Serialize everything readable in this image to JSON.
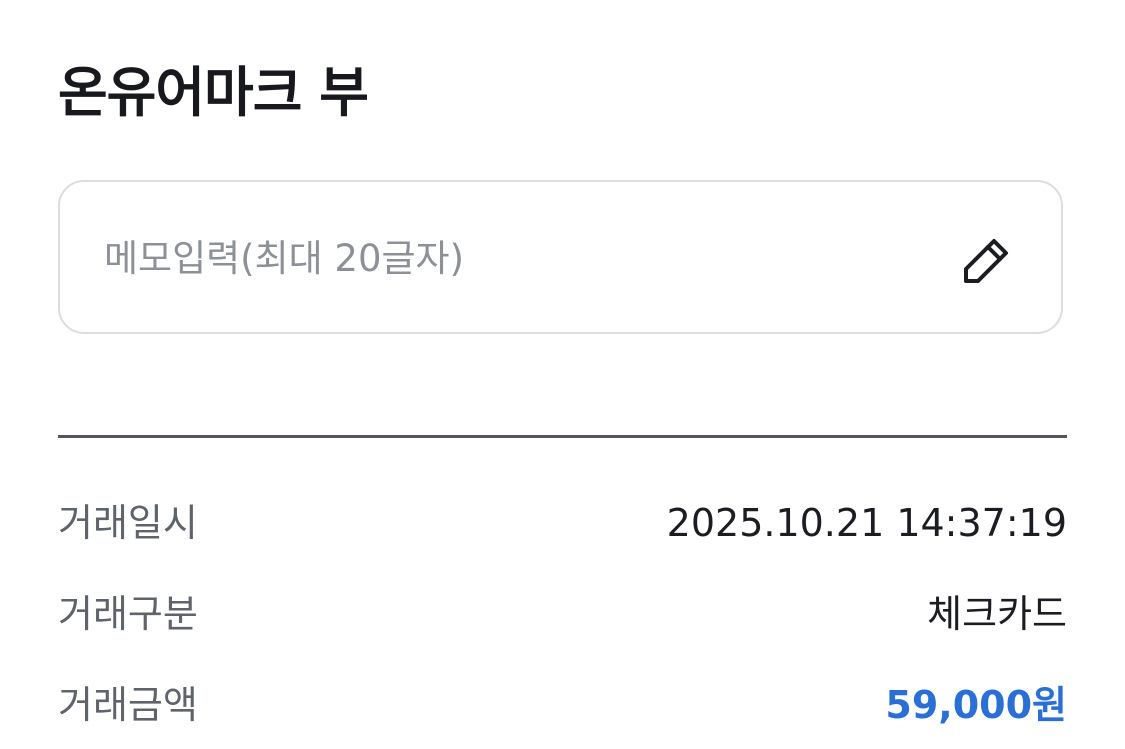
{
  "header": {
    "title": "온유어마크 부"
  },
  "memo": {
    "value": "",
    "placeholder": "메모입력(최대 20글자)",
    "edit_icon": "pencil-icon"
  },
  "details": {
    "datetime": {
      "label": "거래일시",
      "value": "2025.10.21 14:37:19"
    },
    "type": {
      "label": "거래구분",
      "value": "체크카드"
    },
    "amount": {
      "label": "거래금액",
      "value": "59,000원"
    }
  },
  "colors": {
    "amount_accent": "#2a6fd6",
    "label_gray": "#5f636b",
    "placeholder_gray": "#8c9097",
    "divider": "#52555c",
    "box_border": "#dcdde0"
  }
}
